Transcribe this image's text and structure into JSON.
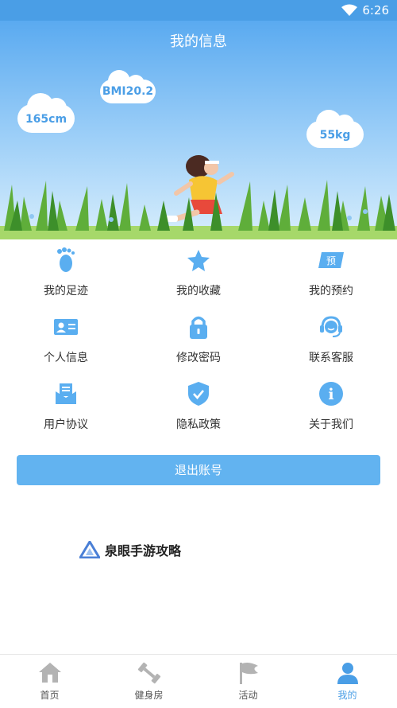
{
  "status": {
    "time": "6:26"
  },
  "header": {
    "title": "我的信息"
  },
  "stats": {
    "height": "165cm",
    "bmi": "BMI20.2",
    "weight": "55kg"
  },
  "menu": [
    {
      "label": "我的足迹",
      "icon": "footprint-icon"
    },
    {
      "label": "我的收藏",
      "icon": "star-icon"
    },
    {
      "label": "我的预约",
      "icon": "reservation-icon",
      "badge": "预"
    },
    {
      "label": "个人信息",
      "icon": "id-card-icon"
    },
    {
      "label": "修改密码",
      "icon": "lock-icon"
    },
    {
      "label": "联系客服",
      "icon": "headset-icon"
    },
    {
      "label": "用户协议",
      "icon": "agreement-icon"
    },
    {
      "label": "隐私政策",
      "icon": "shield-icon"
    },
    {
      "label": "关于我们",
      "icon": "info-icon",
      "glyph": "i"
    }
  ],
  "logout": {
    "label": "退出账号"
  },
  "watermark": {
    "text": "泉眼手游攻略"
  },
  "tabs": [
    {
      "label": "首页",
      "icon": "home-icon"
    },
    {
      "label": "健身房",
      "icon": "dumbbell-icon"
    },
    {
      "label": "活动",
      "icon": "flag-icon"
    },
    {
      "label": "我的",
      "icon": "person-icon",
      "active": true
    }
  ],
  "colors": {
    "accent": "#4a9ee6",
    "button": "#62b3f0",
    "icon": "#5aaef0"
  }
}
